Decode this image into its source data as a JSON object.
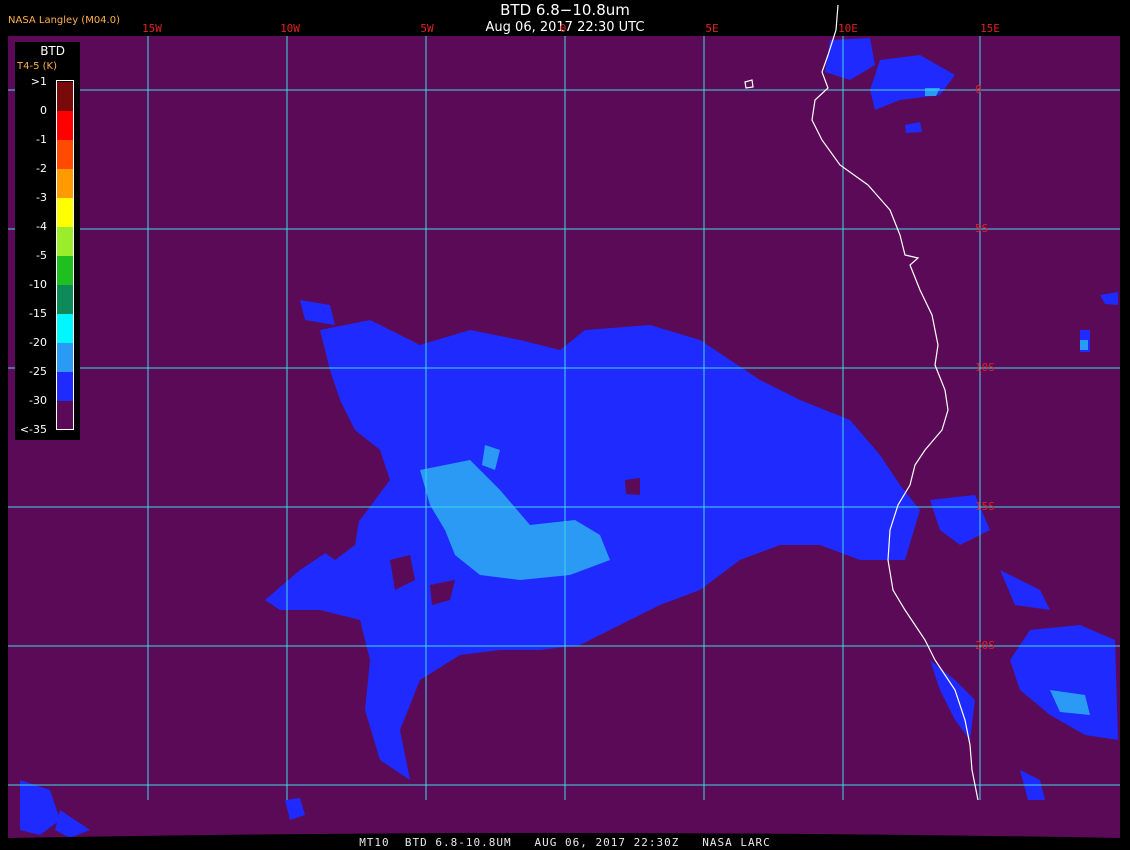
{
  "header": {
    "title": "BTD 6.8−10.8um",
    "subtitle": "Aug 06, 2017 22:30 UTC",
    "credit": "NASA Langley (M04.0)"
  },
  "footer": "MT10  BTD 6.8-10.8UM   AUG 06, 2017 22:30Z   NASA LARC",
  "legend": {
    "title": "BTD",
    "subtitle": "T4-5 (K)",
    "items": [
      {
        "label": ">1",
        "color": "#7a0a0a"
      },
      {
        "label": "0",
        "color": "#ff0000"
      },
      {
        "label": "-1",
        "color": "#ff4a00"
      },
      {
        "label": "-2",
        "color": "#ff9a00"
      },
      {
        "label": "-3",
        "color": "#ffff00"
      },
      {
        "label": "-4",
        "color": "#9bec2a"
      },
      {
        "label": "-5",
        "color": "#1fbf1f"
      },
      {
        "label": "-10",
        "color": "#0e8a5a"
      },
      {
        "label": "-15",
        "color": "#00f7ff"
      },
      {
        "label": "-20",
        "color": "#2a9af5"
      },
      {
        "label": "-25",
        "color": "#1f2aff"
      },
      {
        "label": "-30",
        "color": "#5a0a56"
      },
      {
        "label": "<-35",
        "color": ""
      }
    ]
  },
  "longitude_labels": [
    "15W",
    "10W",
    "5W",
    "0",
    "5E",
    "10E",
    "15E"
  ],
  "latitude_labels": [
    "0",
    "5S",
    "10S",
    "15S",
    "20S"
  ],
  "colors": {
    "background": "#5a0a56",
    "cloud": "#1f2aff",
    "cloud_light": "#2a9af5",
    "grid": "#3fd8e8",
    "coast": "#ffffff",
    "grid_label": "#dd2222"
  }
}
